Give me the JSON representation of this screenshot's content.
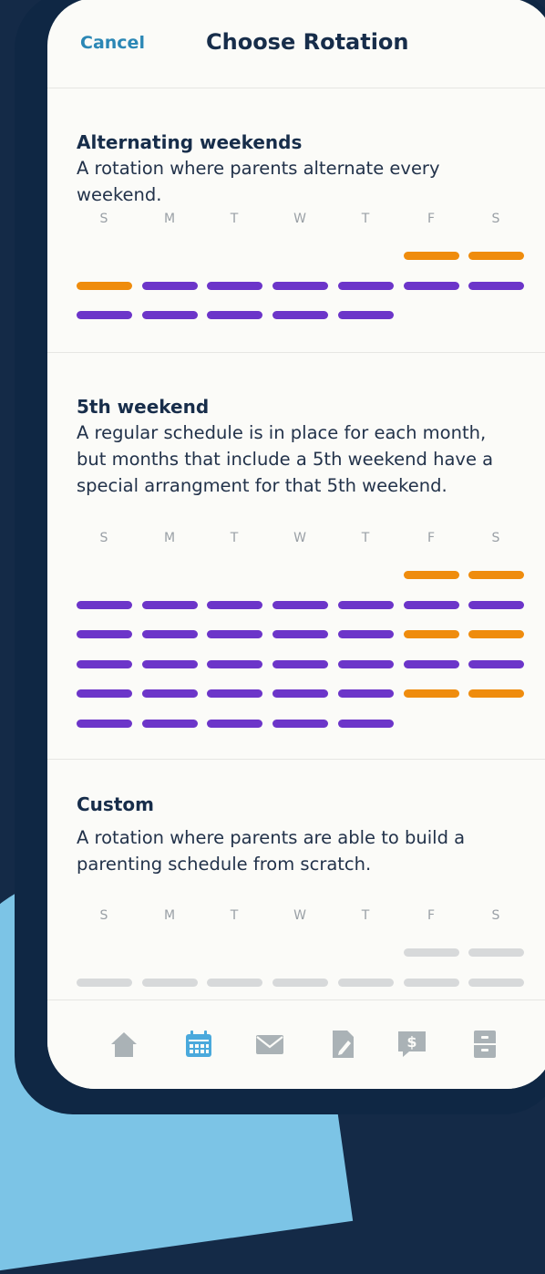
{
  "header": {
    "cancel_label": "Cancel",
    "title": "Choose Rotation"
  },
  "day_labels": [
    "S",
    "M",
    "T",
    "W",
    "T",
    "F",
    "S"
  ],
  "colors": {
    "purple": "#6c35c9",
    "orange": "#ef8c0d",
    "gray": "#d7d9da",
    "active_tab": "#4aa9dc",
    "inactive_tab": "#aab2b6"
  },
  "sections": [
    {
      "title": "Alternating weekends",
      "description": "A rotation where parents alternate every weekend.",
      "rows": [
        [
          "",
          "",
          "",
          "",
          "",
          "orange",
          "orange"
        ],
        [
          "orange",
          "purple",
          "purple",
          "purple",
          "purple",
          "purple",
          "purple"
        ],
        [
          "purple",
          "purple",
          "purple",
          "purple",
          "purple",
          "",
          ""
        ]
      ]
    },
    {
      "title": "5th weekend",
      "description": "A regular schedule is in place for each month, but months that include a 5th weekend have a special arrangment for that 5th weekend.",
      "rows": [
        [
          "",
          "",
          "",
          "",
          "",
          "orange",
          "orange"
        ],
        [
          "purple",
          "purple",
          "purple",
          "purple",
          "purple",
          "purple",
          "purple"
        ],
        [
          "purple",
          "purple",
          "purple",
          "purple",
          "purple",
          "orange",
          "orange"
        ],
        [
          "purple",
          "purple",
          "purple",
          "purple",
          "purple",
          "purple",
          "purple"
        ],
        [
          "purple",
          "purple",
          "purple",
          "purple",
          "purple",
          "orange",
          "orange"
        ],
        [
          "purple",
          "purple",
          "purple",
          "purple",
          "purple",
          "",
          ""
        ]
      ]
    },
    {
      "title": "Custom",
      "description": "A rotation where parents are able to build a parenting schedule from scratch.",
      "rows": [
        [
          "",
          "",
          "",
          "",
          "",
          "gray",
          "gray"
        ],
        [
          "gray",
          "gray",
          "gray",
          "gray",
          "gray",
          "gray",
          "gray"
        ]
      ]
    }
  ],
  "tabs": [
    {
      "icon": "home-icon",
      "active": false
    },
    {
      "icon": "calendar-icon",
      "active": true
    },
    {
      "icon": "mail-icon",
      "active": false
    },
    {
      "icon": "document-edit-icon",
      "active": false
    },
    {
      "icon": "payment-chat-icon",
      "active": false
    },
    {
      "icon": "file-cabinet-icon",
      "active": false
    }
  ]
}
